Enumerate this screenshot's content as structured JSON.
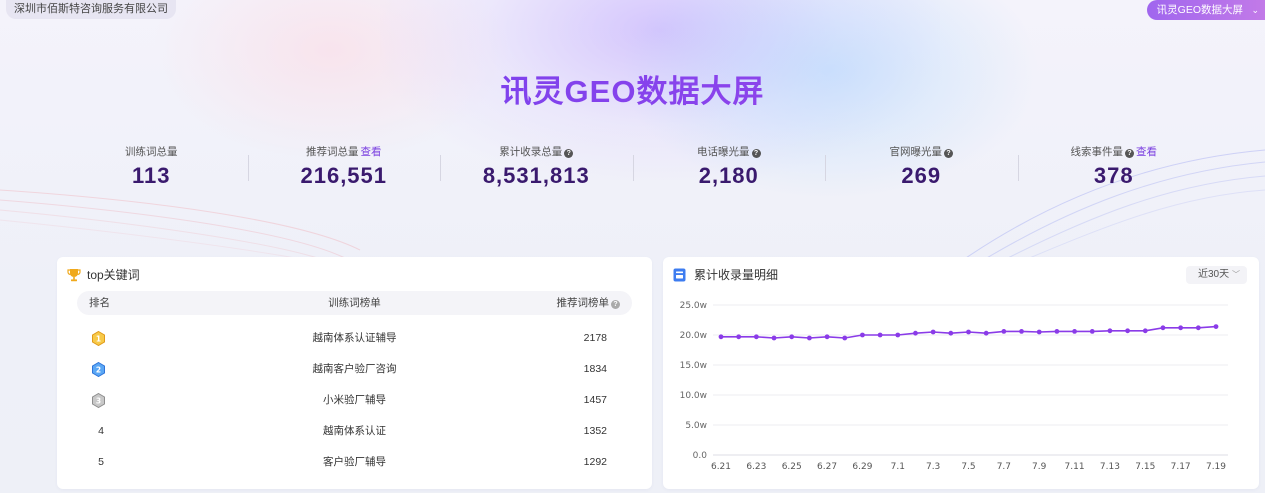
{
  "header": {
    "company": "深圳市佰斯特咨询服务有限公司",
    "screen_switch": "讯灵GEO数据大屏",
    "title": "讯灵GEO数据大屏"
  },
  "stats": [
    {
      "label": "训练词总量",
      "value": "113",
      "link": "",
      "help": false
    },
    {
      "label": "推荐词总量",
      "value": "216,551",
      "link": "查看",
      "help": false
    },
    {
      "label": "累计收录总量",
      "value": "8,531,813",
      "link": "",
      "help": true
    },
    {
      "label": "电话曝光量",
      "value": "2,180",
      "link": "",
      "help": true
    },
    {
      "label": "官网曝光量",
      "value": "269",
      "link": "",
      "help": true
    },
    {
      "label": "线索事件量",
      "value": "378",
      "link": "查看",
      "help": true
    }
  ],
  "keywords": {
    "title": "top关键词",
    "col_rank": "排名",
    "col_word": "训练词榜单",
    "col_rec": "推荐词榜单",
    "rows": [
      {
        "rank": "1",
        "word": "越南体系认证辅导",
        "rec": "2178",
        "medal": "gold"
      },
      {
        "rank": "2",
        "word": "越南客户验厂咨询",
        "rec": "1834",
        "medal": "blue"
      },
      {
        "rank": "3",
        "word": "小米验厂辅导",
        "rec": "1457",
        "medal": "silver"
      },
      {
        "rank": "4",
        "word": "越南体系认证",
        "rec": "1352",
        "medal": ""
      },
      {
        "rank": "5",
        "word": "客户验厂辅导",
        "rec": "1292",
        "medal": ""
      }
    ]
  },
  "chart_card": {
    "title": "累计收录量明细",
    "range_label": "近30天"
  },
  "chart_data": {
    "type": "line",
    "title": "累计收录量明细",
    "xlabel": "",
    "ylabel": "",
    "y_ticks": [
      "0.0",
      "5.0w",
      "10.0w",
      "15.0w",
      "20.0w",
      "25.0w"
    ],
    "x_ticks": [
      "6.21",
      "6.23",
      "6.25",
      "6.27",
      "6.29",
      "7.1",
      "7.3",
      "7.5",
      "7.7",
      "7.9",
      "7.11",
      "7.13",
      "7.15",
      "7.17",
      "7.19"
    ],
    "ylim": [
      0,
      25
    ],
    "y_unit": "w",
    "grid": true,
    "color": "#8a3be8",
    "series": [
      {
        "values": [
          19.7,
          19.7,
          19.7,
          19.5,
          19.7,
          19.5,
          19.7,
          19.5,
          20.0,
          20.0,
          20.0,
          20.3,
          20.5,
          20.3,
          20.5,
          20.3,
          20.6,
          20.6,
          20.5,
          20.6,
          20.6,
          20.6,
          20.7,
          20.7,
          20.7,
          21.2,
          21.2,
          21.2,
          21.4
        ]
      }
    ]
  }
}
